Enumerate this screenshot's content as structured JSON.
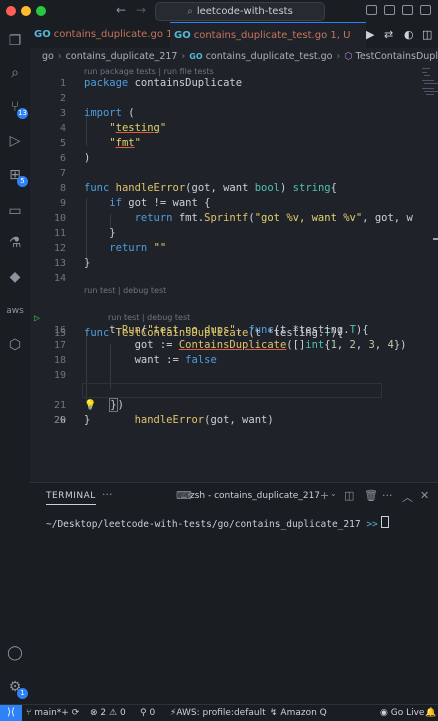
{
  "titlebar": {
    "search_text": "leetcode-with-tests"
  },
  "activity": {
    "scm_badge": "13",
    "extensions_badge": "5",
    "aws_label": "aws",
    "settings_badge": "1"
  },
  "tabs": [
    {
      "icon": "GO",
      "label": "contains_duplicate.go  1, U"
    },
    {
      "icon": "GO",
      "label": "contains_duplicate_test.go  1, U"
    }
  ],
  "breadcrumb": {
    "items": [
      "go",
      "contains_duplicate_217",
      "contains_duplicate_test.go",
      "TestContainsDuplicate"
    ]
  },
  "editor": {
    "codelens": {
      "package": "run package tests | run file tests",
      "test": "run test | debug test",
      "subtest": "run test | debug test"
    },
    "lines": {
      "l1": "1",
      "l2": "2",
      "l3": "3",
      "l4": "4",
      "l5": "5",
      "l6": "6",
      "l7": "7",
      "l8": "8",
      "l9": "9",
      "l10": "10",
      "l11": "11",
      "l12": "12",
      "l13": "13",
      "l14": "14",
      "l15": "15",
      "l16": "16",
      "l17": "17",
      "l18": "18",
      "l19": "19",
      "l20": "20",
      "l21": "21",
      "l22": "22"
    }
  },
  "panel": {
    "title": "TERMINAL",
    "terminal_name": "zsh - contains_duplicate_217",
    "cwd": "~/Desktop/leetcode-with-tests/go/contains_duplicate_217",
    "prompt": ">>"
  },
  "statusbar": {
    "branch": "main*+",
    "errors": "2",
    "warnings": "0",
    "ports": "0",
    "aws_profile": "AWS: profile:default",
    "amazon_q": "Amazon Q",
    "go_live": "Go Live"
  },
  "colors": {
    "accent": "#2f81f7",
    "keyword": "#4f9dde",
    "string": "#e4d26c",
    "type": "#4fc1b0",
    "modified": "#c8745c"
  }
}
